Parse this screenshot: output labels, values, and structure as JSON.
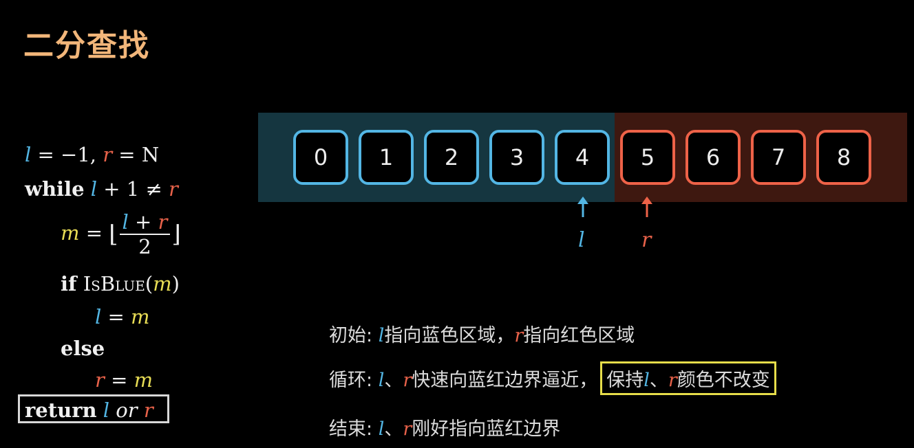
{
  "title": "二分查找",
  "code": {
    "init": {
      "l": "l",
      "eq1": " = −1, ",
      "r": "r",
      "eq2": " = N"
    },
    "loop": {
      "kw": "while",
      "l": "l",
      "mid": " + 1 ≠ ",
      "r": "r"
    },
    "assign": {
      "m": "m",
      "eq": " = ",
      "num_l": "l",
      "plus": " + ",
      "num_r": "r",
      "den": "2",
      "floor_l": "⌊",
      "floor_r": "⌋"
    },
    "cond": {
      "kw": "if",
      "fn": "IsBlue",
      "open": "(",
      "m": "m",
      "close": ")"
    },
    "then": {
      "l": "l",
      "eq": " = ",
      "m": "m"
    },
    "else": {
      "kw": "else"
    },
    "else_assign": {
      "r": "r",
      "eq": " = ",
      "m": "m"
    },
    "ret": {
      "kw": "return",
      "l": "l",
      "or": "or",
      "r": "r"
    }
  },
  "array": {
    "cells": [
      {
        "label": "0",
        "color": "blue"
      },
      {
        "label": "1",
        "color": "blue"
      },
      {
        "label": "2",
        "color": "blue"
      },
      {
        "label": "3",
        "color": "blue"
      },
      {
        "label": "4",
        "color": "blue"
      },
      {
        "label": "5",
        "color": "red"
      },
      {
        "label": "6",
        "color": "red"
      },
      {
        "label": "7",
        "color": "red"
      },
      {
        "label": "8",
        "color": "red"
      }
    ],
    "pointer_l": "l",
    "pointer_r": "r"
  },
  "desc": {
    "init": {
      "prefix": "初始: ",
      "l": "l",
      "a": "指向蓝色区域，",
      "r": "r",
      "b": "指向红色区域"
    },
    "loop": {
      "prefix": "循环: ",
      "l": "l",
      "sep": "、",
      "r": "r",
      "a": "快速向蓝红边界逼近，",
      "hl_a": "保持",
      "hl_l": "l",
      "hl_sep": "、",
      "hl_r": "r",
      "hl_b": "颜色不改变"
    },
    "end": {
      "prefix": "结束: ",
      "l": "l",
      "sep": "、",
      "r": "r",
      "a": "刚好指向蓝红边界"
    }
  },
  "colors": {
    "title": "#f2b67a",
    "blue": "#53b6e4",
    "red": "#e8624a",
    "yellow": "#e7dc55",
    "blue_region": "#153640",
    "red_region": "#3e1810"
  }
}
